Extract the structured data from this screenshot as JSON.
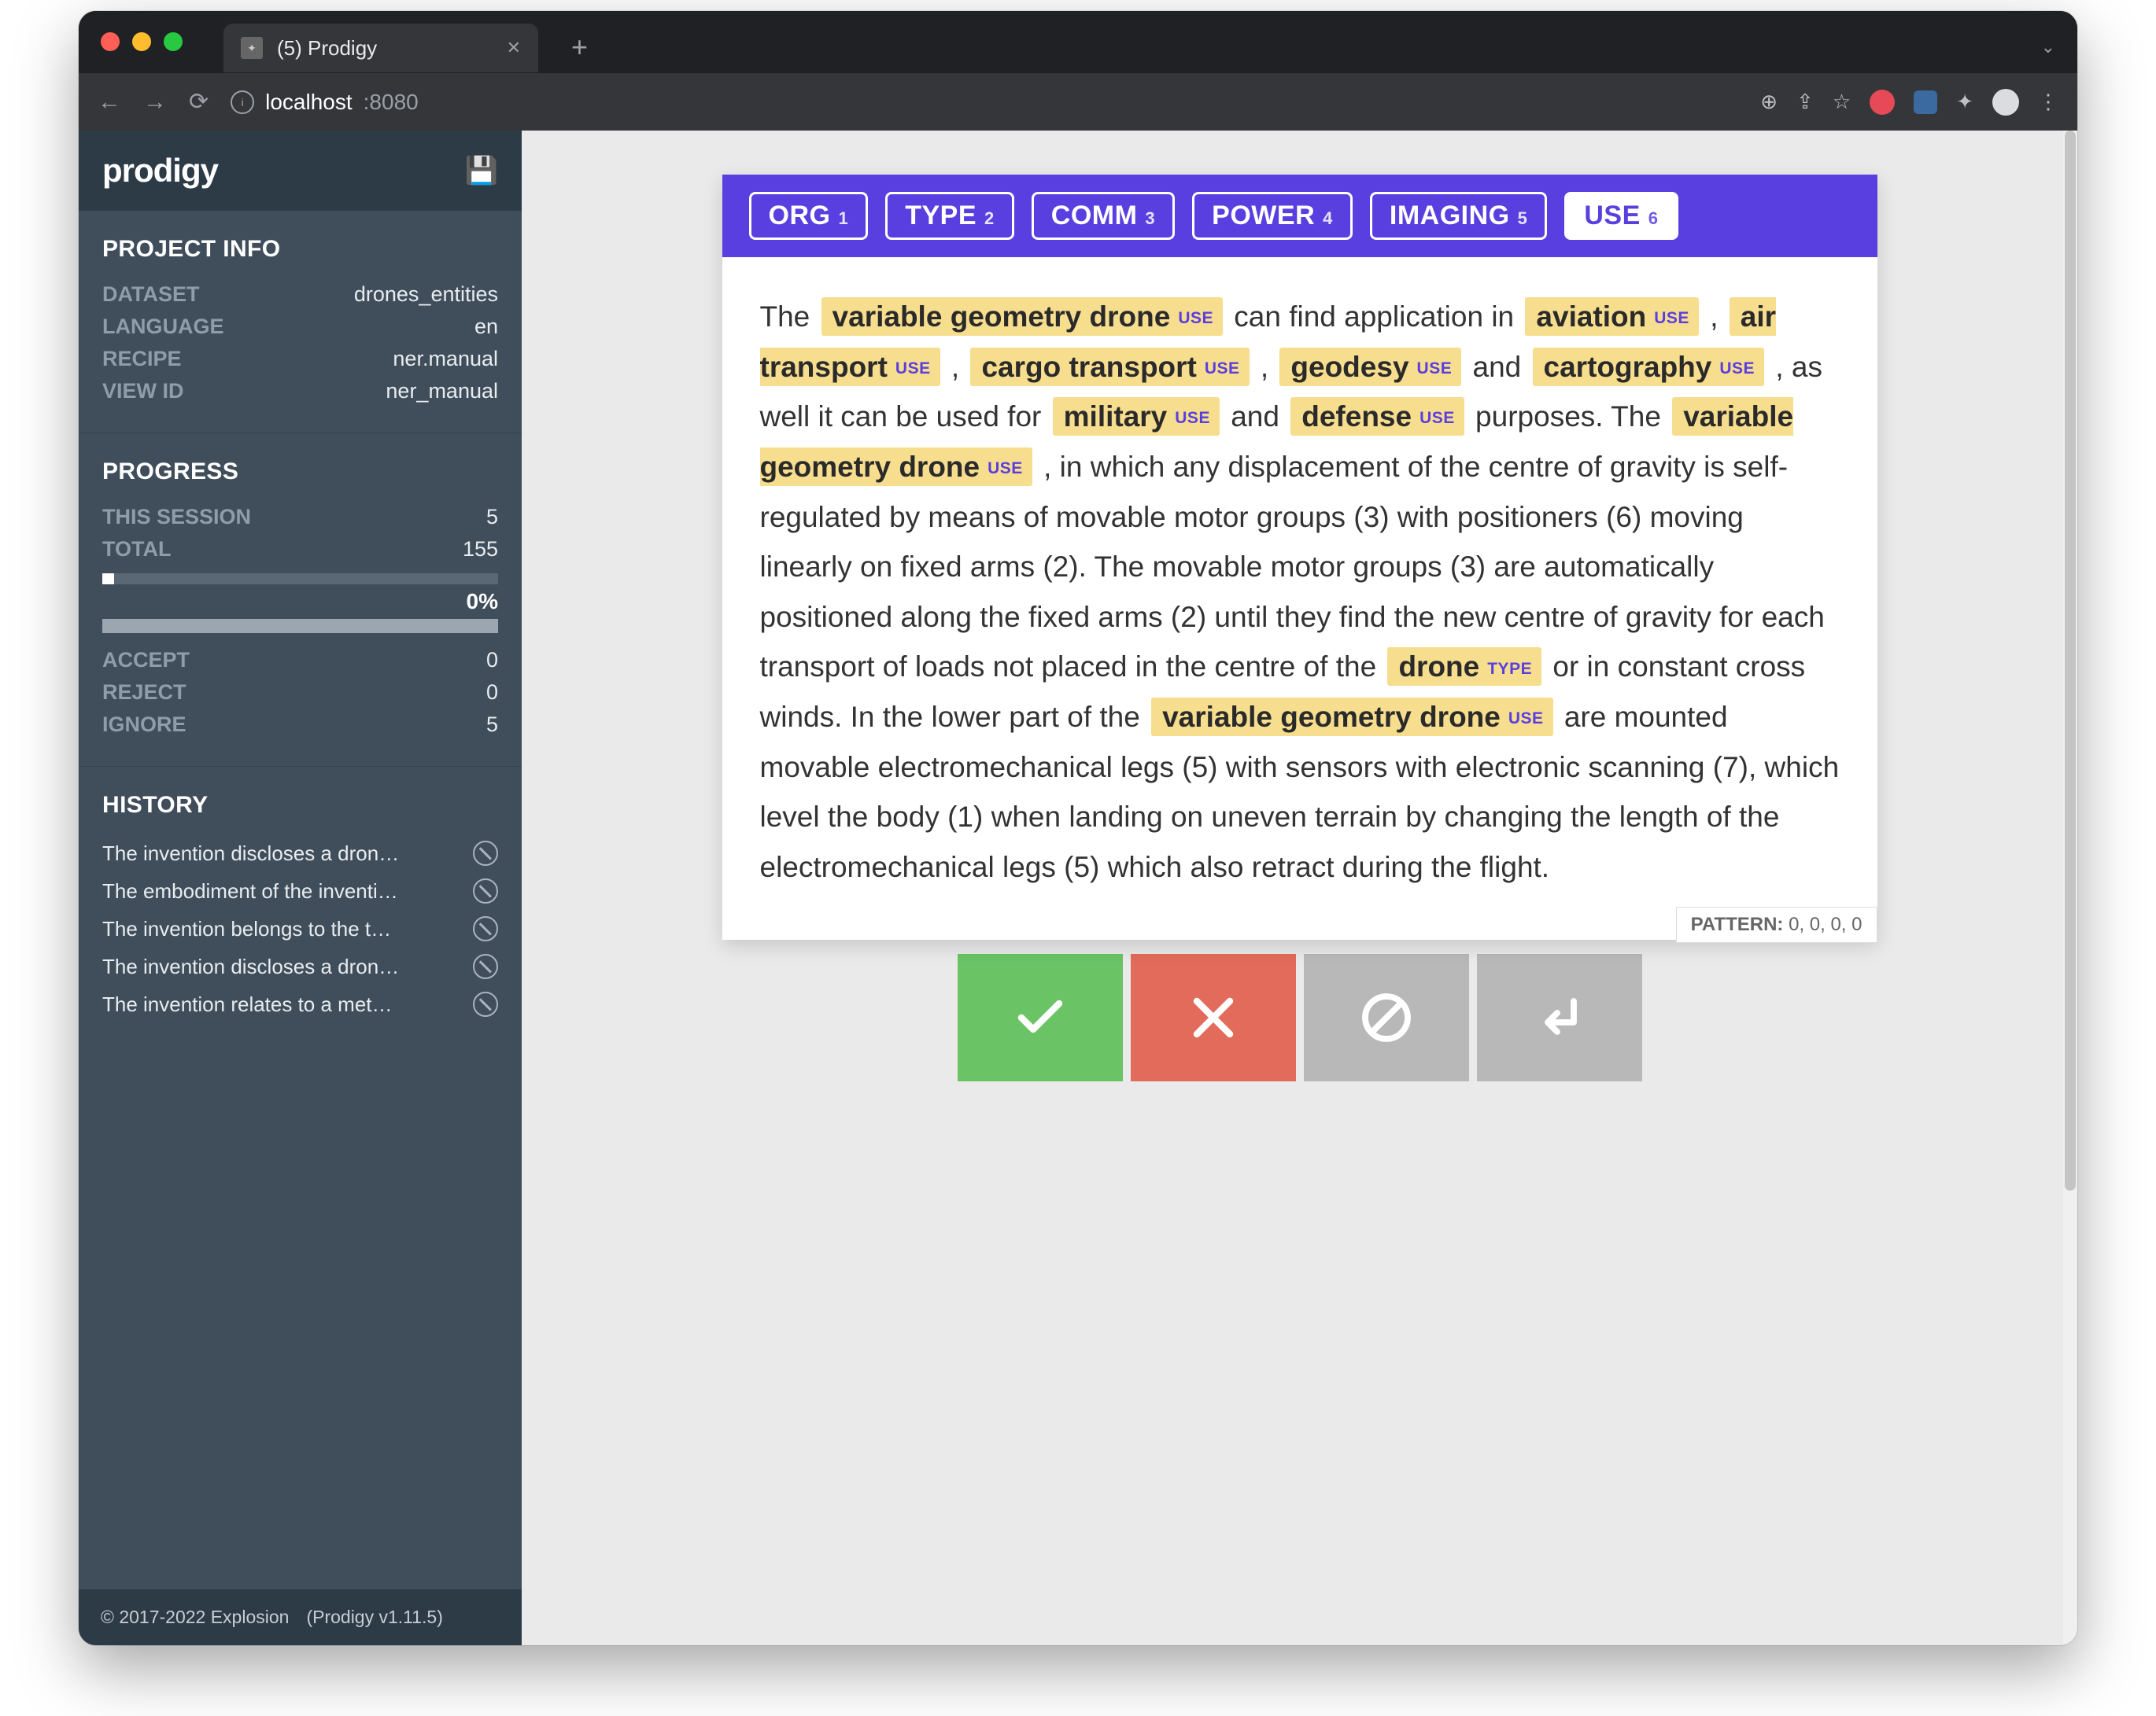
{
  "browser": {
    "tab_title": "(5) Prodigy",
    "url_host": "localhost",
    "url_port": ":8080"
  },
  "sidebar": {
    "logo": "prodigy",
    "project_info": {
      "title": "PROJECT INFO",
      "rows": [
        {
          "lab": "DATASET",
          "val": "drones_entities"
        },
        {
          "lab": "LANGUAGE",
          "val": "en"
        },
        {
          "lab": "RECIPE",
          "val": "ner.manual"
        },
        {
          "lab": "VIEW ID",
          "val": "ner_manual"
        }
      ]
    },
    "progress": {
      "title": "PROGRESS",
      "session_lab": "THIS SESSION",
      "session_val": "5",
      "total_lab": "TOTAL",
      "total_val": "155",
      "pct": "0%",
      "counts": [
        {
          "lab": "ACCEPT",
          "val": "0"
        },
        {
          "lab": "REJECT",
          "val": "0"
        },
        {
          "lab": "IGNORE",
          "val": "5"
        }
      ]
    },
    "history": {
      "title": "HISTORY",
      "items": [
        "The invention discloses a dron…",
        "The embodiment of the inventi…",
        "The invention belongs to the t…",
        "The invention discloses a dron…",
        "The invention relates to a met…"
      ]
    },
    "footer": {
      "copyright": "© 2017-2022 Explosion",
      "version": "(Prodigy v1.11.5)"
    }
  },
  "labels": [
    {
      "name": "ORG",
      "key": "1",
      "active": false
    },
    {
      "name": "TYPE",
      "key": "2",
      "active": false
    },
    {
      "name": "COMM",
      "key": "3",
      "active": false
    },
    {
      "name": "POWER",
      "key": "4",
      "active": false
    },
    {
      "name": "IMAGING",
      "key": "5",
      "active": false
    },
    {
      "name": "USE",
      "key": "6",
      "active": true
    }
  ],
  "text_tokens": [
    {
      "t": "The "
    },
    {
      "t": "variable geometry drone",
      "label": "USE"
    },
    {
      "t": " can find application in "
    },
    {
      "t": "aviation",
      "label": "USE"
    },
    {
      "t": " , "
    },
    {
      "t": "air transport",
      "label": "USE"
    },
    {
      "t": " , "
    },
    {
      "t": "cargo transport",
      "label": "USE"
    },
    {
      "t": " , "
    },
    {
      "t": "geodesy",
      "label": "USE"
    },
    {
      "t": " and "
    },
    {
      "t": "cartography",
      "label": "USE"
    },
    {
      "t": " , as well it can be used for "
    },
    {
      "t": "military",
      "label": "USE"
    },
    {
      "t": " and "
    },
    {
      "t": "defense",
      "label": "USE"
    },
    {
      "t": " purposes. The "
    },
    {
      "t": "variable geometry drone",
      "label": "USE"
    },
    {
      "t": " , in which any displacement of the centre of gravity is self-regulated by means of movable motor groups (3) with positioners (6) moving linearly on fixed arms (2). The movable motor groups (3) are automatically positioned along the fixed arms (2) until they find the new centre of gravity for each transport of loads not placed in the centre of the "
    },
    {
      "t": "drone",
      "label": "TYPE"
    },
    {
      "t": " or in constant cross winds. In the lower part of the "
    },
    {
      "t": "variable geometry drone",
      "label": "USE"
    },
    {
      "t": " are mounted movable electromechanical legs (5) with sensors with electronic scanning (7), which level the body (1) when landing on uneven terrain by changing the length of the electromechanical legs (5) which also retract during the flight."
    }
  ],
  "pattern_label": "PATTERN:",
  "pattern_value": "0, 0, 0, 0"
}
